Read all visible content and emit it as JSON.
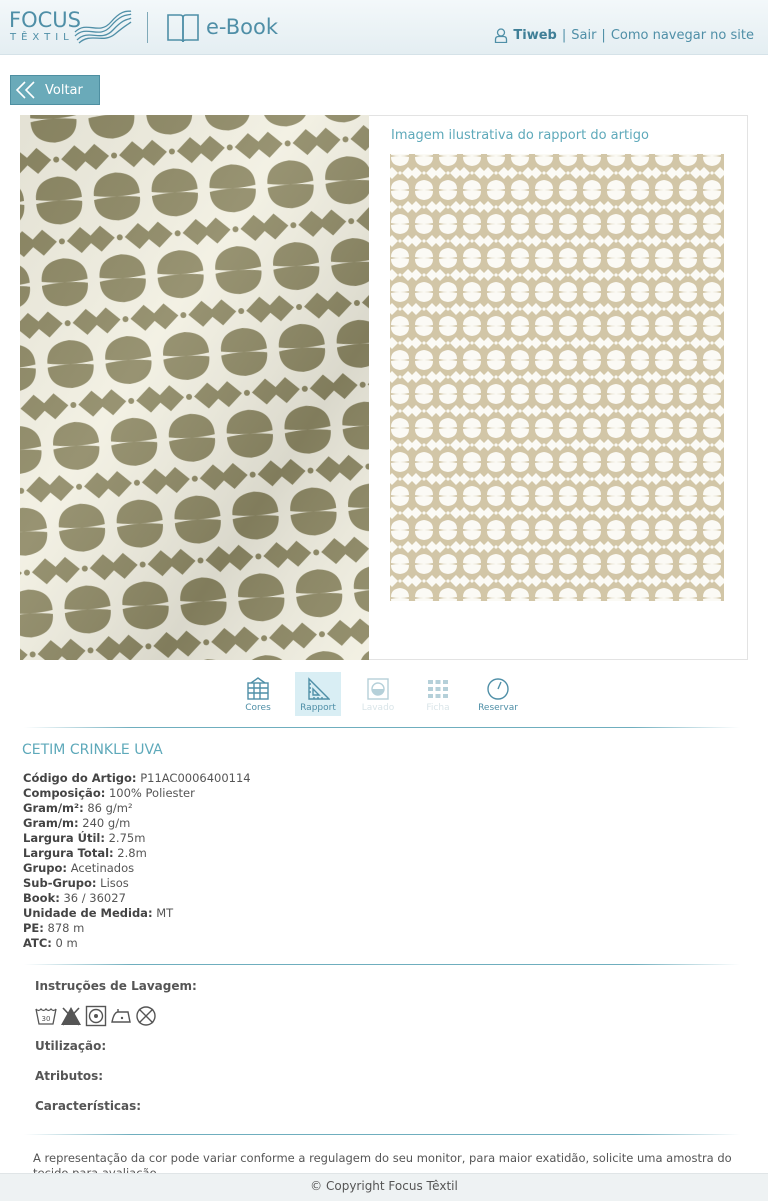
{
  "header": {
    "logo_word": "FOCUS",
    "logo_sub": "TÊXTIL",
    "section_label": "e-Book",
    "user_name": "Tiweb",
    "logout_label": "Sair",
    "help_label": "Como navegar no site",
    "separator": "|"
  },
  "back_button": {
    "label": "Voltar"
  },
  "rapport": {
    "title": "Imagem ilustrativa do rapport do artigo"
  },
  "toolbar": {
    "items": [
      {
        "label": "Cores",
        "icon": "palette-grid-icon",
        "state": "enabled"
      },
      {
        "label": "Rapport",
        "icon": "set-square-icon",
        "state": "active"
      },
      {
        "label": "Lavado",
        "icon": "washed-icon",
        "state": "disabled"
      },
      {
        "label": "Ficha",
        "icon": "grid-icon",
        "state": "disabled"
      },
      {
        "label": "Reservar",
        "icon": "clock-icon",
        "state": "enabled"
      }
    ]
  },
  "product": {
    "name": "CETIM CRINKLE UVA",
    "specs": [
      {
        "label": "Código do Artigo:",
        "value": "P11AC0006400114"
      },
      {
        "label": "Composição:",
        "value": "100% Poliester"
      },
      {
        "label": "Gram/m²:",
        "value": "86 g/m²"
      },
      {
        "label": "Gram/m:",
        "value": "240 g/m"
      },
      {
        "label": "Largura Útil:",
        "value": "2.75m"
      },
      {
        "label": "Largura Total:",
        "value": "2.8m"
      },
      {
        "label": "Grupo:",
        "value": "Acetinados"
      },
      {
        "label": "Sub-Grupo:",
        "value": "Lisos"
      },
      {
        "label": "Book:",
        "value": "36 / 36027"
      },
      {
        "label": "Unidade de Medida:",
        "value": "MT"
      },
      {
        "label": "PE:",
        "value": "878 m"
      },
      {
        "label": "ATC:",
        "value": "0 m"
      }
    ]
  },
  "care": {
    "title": "Instruções de Lavagem:",
    "icons": [
      "wash-30-icon",
      "no-bleach-icon",
      "tumble-dry-icon",
      "iron-low-icon",
      "no-dry-clean-icon"
    ],
    "wash_temp": "30",
    "usage_label": "Utilização:",
    "attributes_label": "Atributos:",
    "characteristics_label": "Características:"
  },
  "disclaimer": "A representação da cor pode variar conforme a regulagem do seu monitor, para maior exatidão, solicite uma amostra do tecido para avaliação.",
  "footer": {
    "copyright": "© Copyright Focus Têxtil"
  },
  "colors": {
    "brand": "#4f8fa7",
    "accent": "#5ea9ba",
    "button": "#6aaab9",
    "fabric_print": "#8f8a66",
    "fabric_base": "#f2f0e2",
    "rapport_print": "#d2c6a7"
  }
}
